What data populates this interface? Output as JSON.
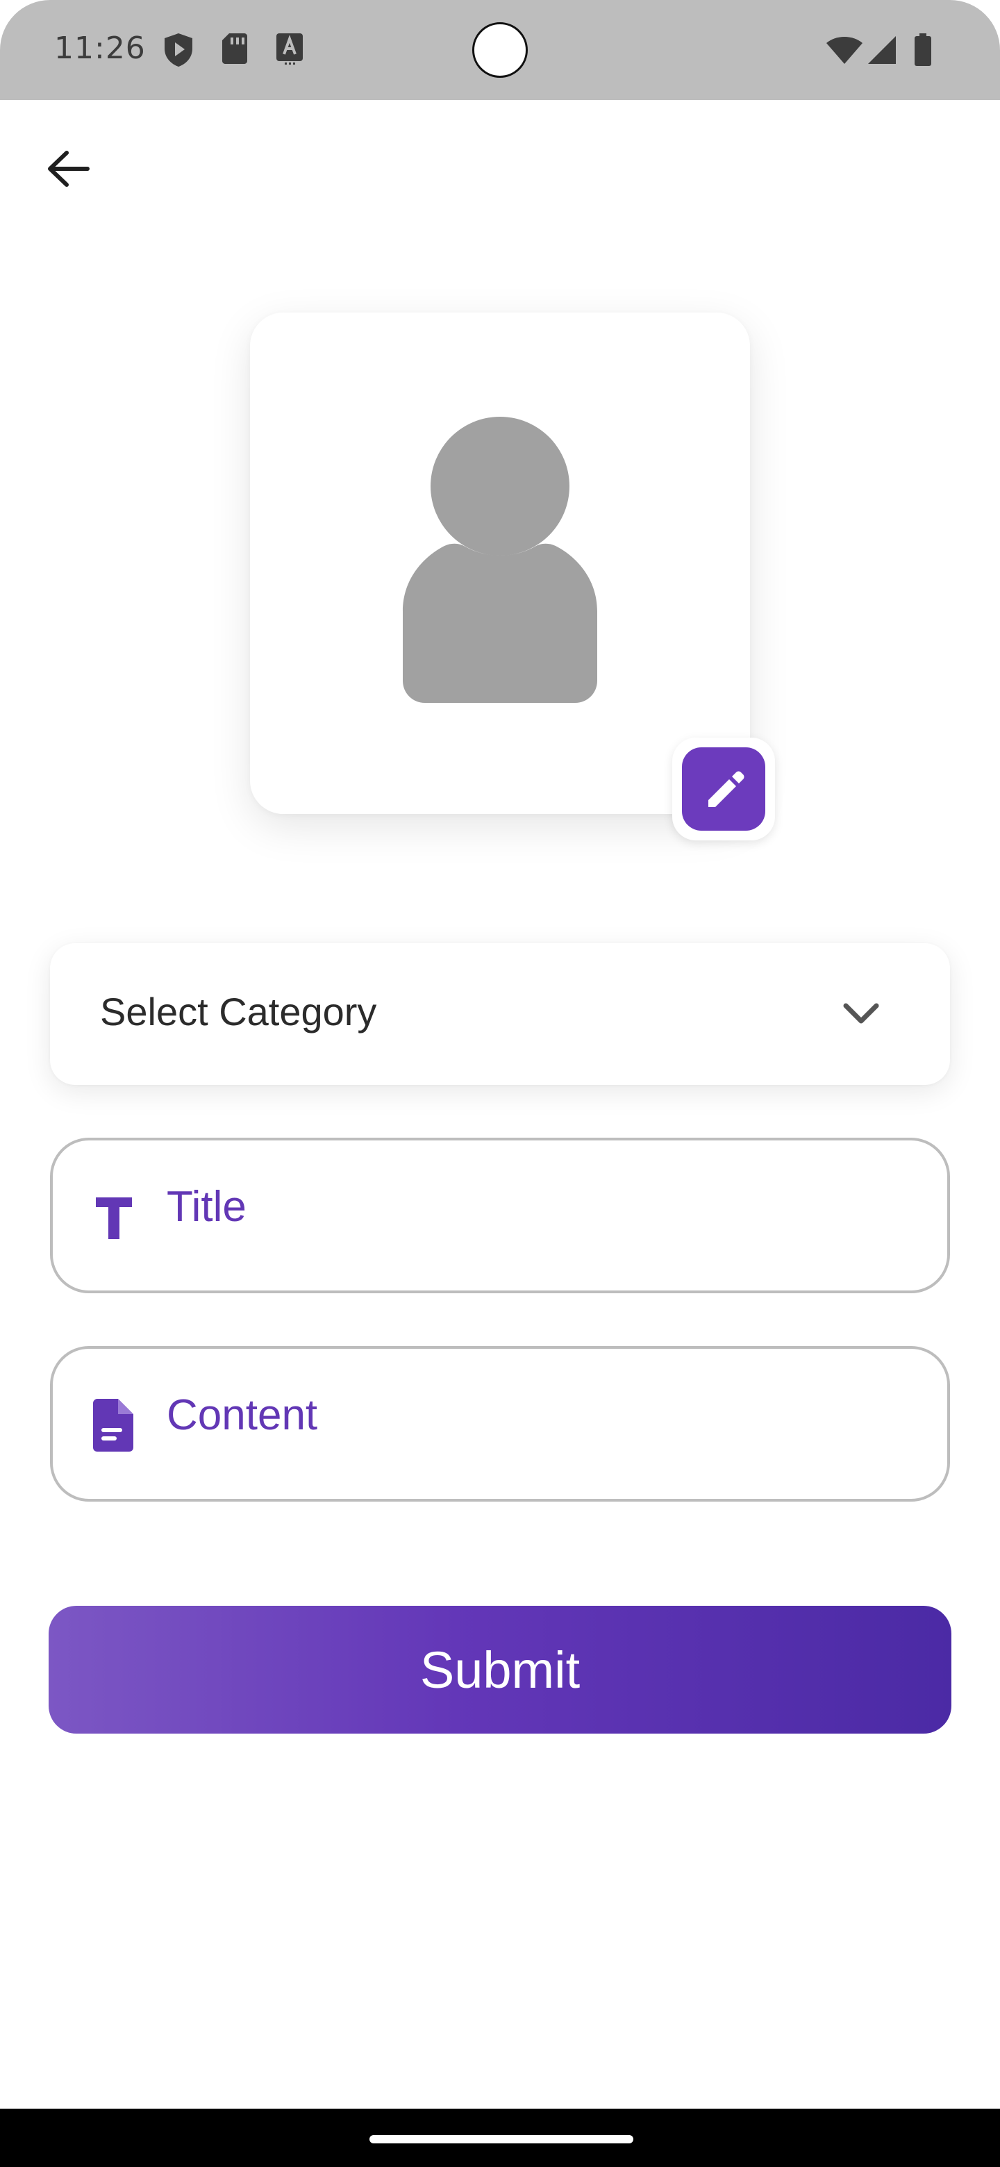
{
  "status_bar": {
    "time": "11:26",
    "icons": [
      "shield-play-icon",
      "sd-card-icon",
      "keyboard-a-icon",
      "wifi-icon",
      "signal-icon",
      "battery-icon"
    ]
  },
  "header": {
    "back_icon": "arrow-left-icon"
  },
  "avatar": {
    "placeholder_icon": "person-icon",
    "edit_icon": "pencil-icon"
  },
  "form": {
    "category": {
      "placeholder": "Select Category",
      "icon": "chevron-down-icon"
    },
    "title": {
      "placeholder": "Title",
      "icon": "text-t-icon"
    },
    "content": {
      "placeholder": "Content",
      "icon": "document-icon"
    },
    "submit_label": "Submit"
  },
  "colors": {
    "accent": "#6237b5",
    "gradient_start": "#7c57c4",
    "gradient_end": "#4b2aa5",
    "placeholder_avatar": "#a1a1a1",
    "status_bar": "#bdbdbd"
  }
}
